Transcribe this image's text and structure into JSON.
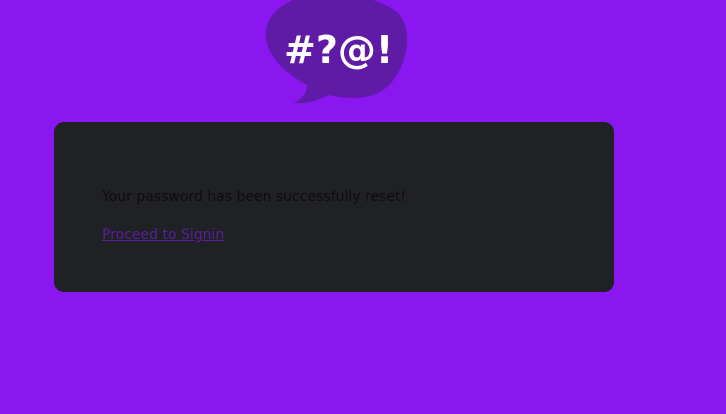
{
  "logo": {
    "text": "#?@!",
    "icon": "speech-bubble-icon",
    "color": "#5f1aa6"
  },
  "page": {
    "background": "#8a17f0"
  },
  "card": {
    "background": "#202124",
    "message": "Your password has been successfully reset!",
    "link_label": "Proceed to Signin"
  }
}
